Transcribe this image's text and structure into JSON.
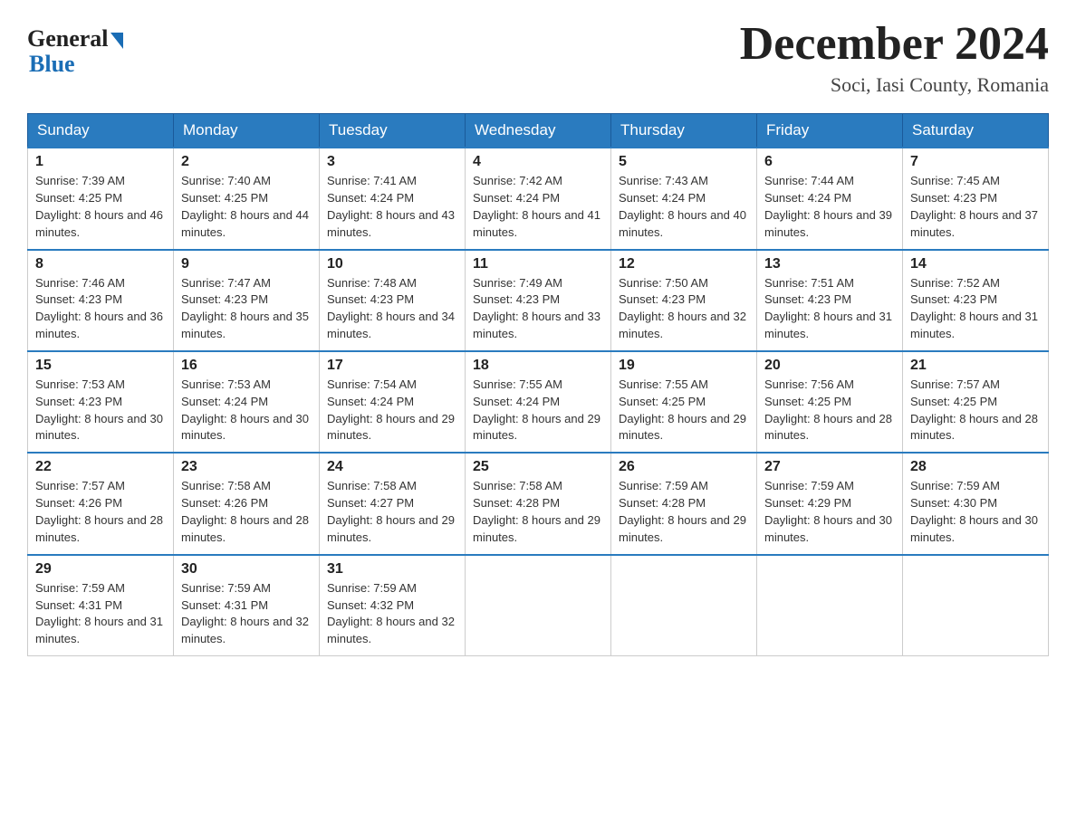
{
  "header": {
    "logo_general": "General",
    "logo_blue": "Blue",
    "month_title": "December 2024",
    "location": "Soci, Iasi County, Romania"
  },
  "days_of_week": [
    "Sunday",
    "Monday",
    "Tuesday",
    "Wednesday",
    "Thursday",
    "Friday",
    "Saturday"
  ],
  "weeks": [
    [
      {
        "day": "1",
        "sunrise": "7:39 AM",
        "sunset": "4:25 PM",
        "daylight": "8 hours and 46 minutes."
      },
      {
        "day": "2",
        "sunrise": "7:40 AM",
        "sunset": "4:25 PM",
        "daylight": "8 hours and 44 minutes."
      },
      {
        "day": "3",
        "sunrise": "7:41 AM",
        "sunset": "4:24 PM",
        "daylight": "8 hours and 43 minutes."
      },
      {
        "day": "4",
        "sunrise": "7:42 AM",
        "sunset": "4:24 PM",
        "daylight": "8 hours and 41 minutes."
      },
      {
        "day": "5",
        "sunrise": "7:43 AM",
        "sunset": "4:24 PM",
        "daylight": "8 hours and 40 minutes."
      },
      {
        "day": "6",
        "sunrise": "7:44 AM",
        "sunset": "4:24 PM",
        "daylight": "8 hours and 39 minutes."
      },
      {
        "day": "7",
        "sunrise": "7:45 AM",
        "sunset": "4:23 PM",
        "daylight": "8 hours and 37 minutes."
      }
    ],
    [
      {
        "day": "8",
        "sunrise": "7:46 AM",
        "sunset": "4:23 PM",
        "daylight": "8 hours and 36 minutes."
      },
      {
        "day": "9",
        "sunrise": "7:47 AM",
        "sunset": "4:23 PM",
        "daylight": "8 hours and 35 minutes."
      },
      {
        "day": "10",
        "sunrise": "7:48 AM",
        "sunset": "4:23 PM",
        "daylight": "8 hours and 34 minutes."
      },
      {
        "day": "11",
        "sunrise": "7:49 AM",
        "sunset": "4:23 PM",
        "daylight": "8 hours and 33 minutes."
      },
      {
        "day": "12",
        "sunrise": "7:50 AM",
        "sunset": "4:23 PM",
        "daylight": "8 hours and 32 minutes."
      },
      {
        "day": "13",
        "sunrise": "7:51 AM",
        "sunset": "4:23 PM",
        "daylight": "8 hours and 31 minutes."
      },
      {
        "day": "14",
        "sunrise": "7:52 AM",
        "sunset": "4:23 PM",
        "daylight": "8 hours and 31 minutes."
      }
    ],
    [
      {
        "day": "15",
        "sunrise": "7:53 AM",
        "sunset": "4:23 PM",
        "daylight": "8 hours and 30 minutes."
      },
      {
        "day": "16",
        "sunrise": "7:53 AM",
        "sunset": "4:24 PM",
        "daylight": "8 hours and 30 minutes."
      },
      {
        "day": "17",
        "sunrise": "7:54 AM",
        "sunset": "4:24 PM",
        "daylight": "8 hours and 29 minutes."
      },
      {
        "day": "18",
        "sunrise": "7:55 AM",
        "sunset": "4:24 PM",
        "daylight": "8 hours and 29 minutes."
      },
      {
        "day": "19",
        "sunrise": "7:55 AM",
        "sunset": "4:25 PM",
        "daylight": "8 hours and 29 minutes."
      },
      {
        "day": "20",
        "sunrise": "7:56 AM",
        "sunset": "4:25 PM",
        "daylight": "8 hours and 28 minutes."
      },
      {
        "day": "21",
        "sunrise": "7:57 AM",
        "sunset": "4:25 PM",
        "daylight": "8 hours and 28 minutes."
      }
    ],
    [
      {
        "day": "22",
        "sunrise": "7:57 AM",
        "sunset": "4:26 PM",
        "daylight": "8 hours and 28 minutes."
      },
      {
        "day": "23",
        "sunrise": "7:58 AM",
        "sunset": "4:26 PM",
        "daylight": "8 hours and 28 minutes."
      },
      {
        "day": "24",
        "sunrise": "7:58 AM",
        "sunset": "4:27 PM",
        "daylight": "8 hours and 29 minutes."
      },
      {
        "day": "25",
        "sunrise": "7:58 AM",
        "sunset": "4:28 PM",
        "daylight": "8 hours and 29 minutes."
      },
      {
        "day": "26",
        "sunrise": "7:59 AM",
        "sunset": "4:28 PM",
        "daylight": "8 hours and 29 minutes."
      },
      {
        "day": "27",
        "sunrise": "7:59 AM",
        "sunset": "4:29 PM",
        "daylight": "8 hours and 30 minutes."
      },
      {
        "day": "28",
        "sunrise": "7:59 AM",
        "sunset": "4:30 PM",
        "daylight": "8 hours and 30 minutes."
      }
    ],
    [
      {
        "day": "29",
        "sunrise": "7:59 AM",
        "sunset": "4:31 PM",
        "daylight": "8 hours and 31 minutes."
      },
      {
        "day": "30",
        "sunrise": "7:59 AM",
        "sunset": "4:31 PM",
        "daylight": "8 hours and 32 minutes."
      },
      {
        "day": "31",
        "sunrise": "7:59 AM",
        "sunset": "4:32 PM",
        "daylight": "8 hours and 32 minutes."
      },
      null,
      null,
      null,
      null
    ]
  ]
}
